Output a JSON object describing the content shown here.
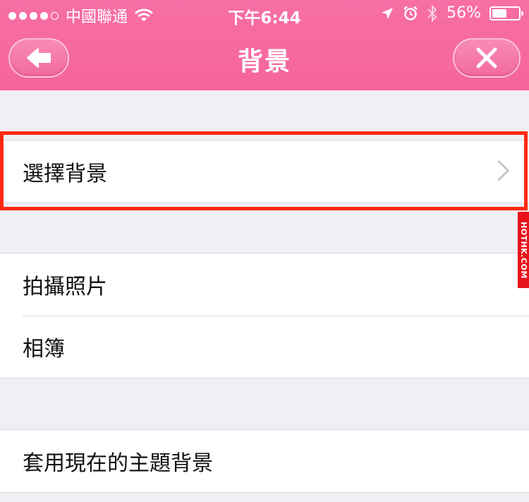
{
  "status_bar": {
    "carrier": "中國聯通",
    "time": "下午6:44",
    "battery": "56%",
    "battery_level": 0.56,
    "signal_bars_filled": 4,
    "signal_bars_total": 5
  },
  "nav": {
    "title": "背景",
    "back_icon": "back-arrow-icon",
    "close_icon": "close-icon"
  },
  "groups": [
    {
      "rows": [
        {
          "label": "選擇背景",
          "disclosure": true
        }
      ]
    },
    {
      "rows": [
        {
          "label": "拍攝照片"
        },
        {
          "label": "相簿"
        }
      ]
    },
    {
      "rows": [
        {
          "label": "套用現在的主題背景"
        }
      ]
    }
  ],
  "watermark": "HOTHK.COM",
  "colors": {
    "header": "#f76fa4",
    "highlight": "#ff2a10",
    "background": "#efeff4"
  }
}
